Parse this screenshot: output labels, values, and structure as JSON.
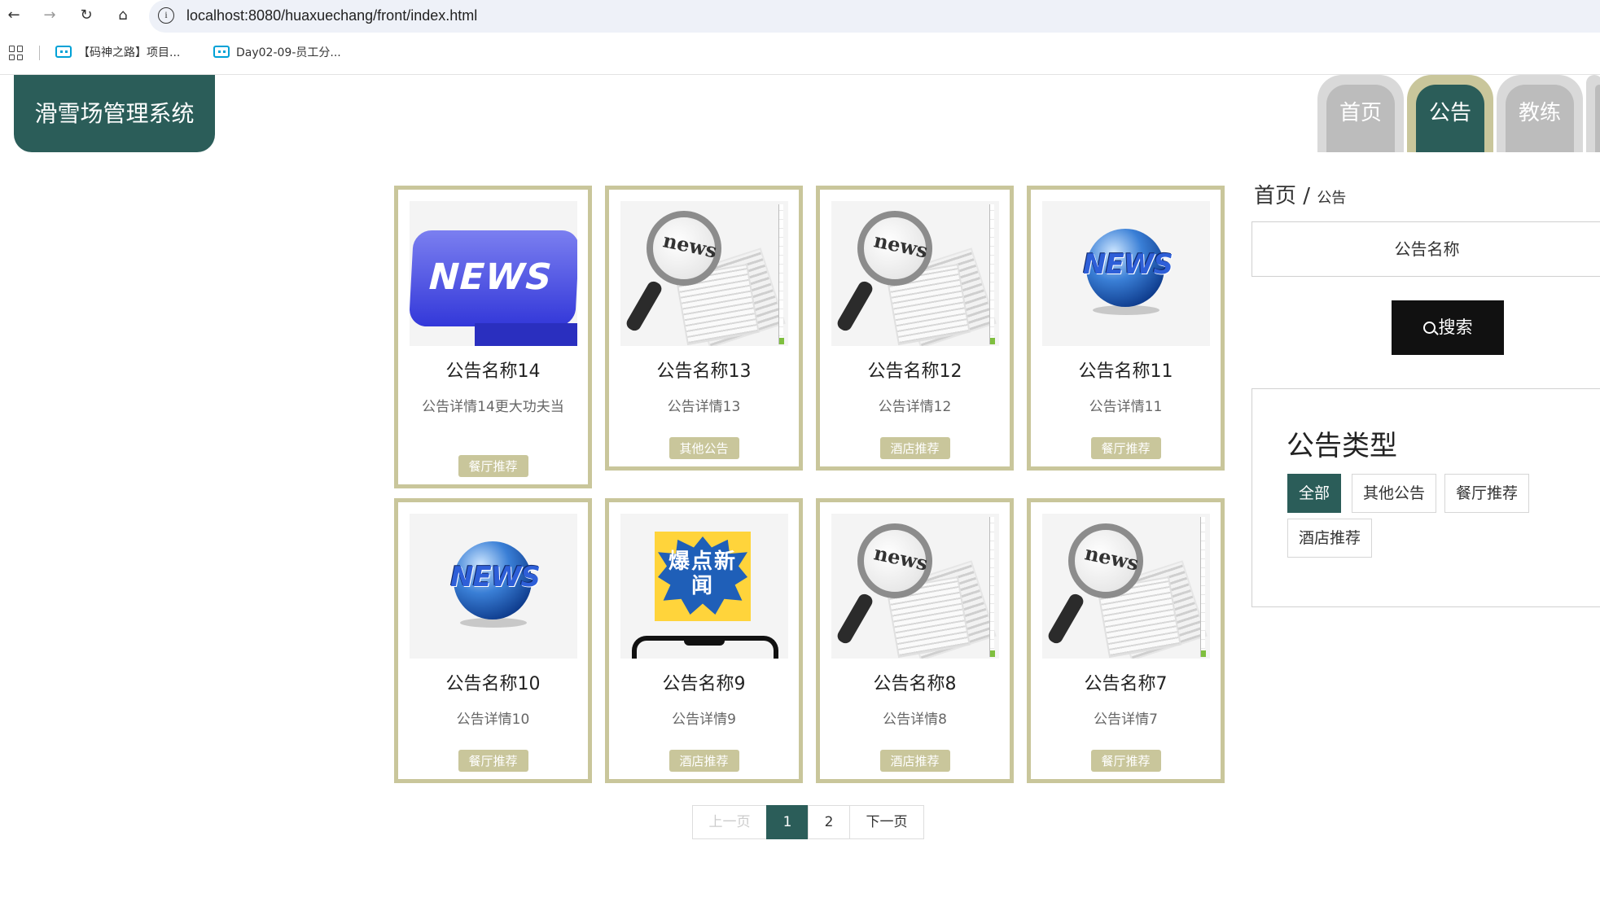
{
  "browser": {
    "url": "localhost:8080/huaxuechang/front/index.html",
    "bookmarks": [
      "【码神之路】项目...",
      "Day02-09-员工分..."
    ]
  },
  "header": {
    "logo_text": "滑雪场管理系统",
    "nav": [
      "首页",
      "公告",
      "教练"
    ],
    "active_nav": "公告"
  },
  "cards": [
    {
      "title": "公告名称14",
      "desc": "公告详情14更大功夫当",
      "tag": "餐厅推荐",
      "image": "news-keyboard-image"
    },
    {
      "title": "公告名称13",
      "desc": "公告详情13",
      "tag": "其他公告",
      "image": "magnifier-newspaper-image"
    },
    {
      "title": "公告名称12",
      "desc": "公告详情12",
      "tag": "酒店推荐",
      "image": "magnifier-newspaper-image"
    },
    {
      "title": "公告名称11",
      "desc": "公告详情11",
      "tag": "餐厅推荐",
      "image": "news-globe-image"
    },
    {
      "title": "公告名称10",
      "desc": "公告详情10",
      "tag": "餐厅推荐",
      "image": "news-globe-image"
    },
    {
      "title": "公告名称9",
      "desc": "公告详情9",
      "tag": "酒店推荐",
      "image": "breaking-news-image"
    },
    {
      "title": "公告名称8",
      "desc": "公告详情8",
      "tag": "酒店推荐",
      "image": "magnifier-newspaper-image"
    },
    {
      "title": "公告名称7",
      "desc": "公告详情7",
      "tag": "餐厅推荐",
      "image": "magnifier-newspaper-image"
    }
  ],
  "image_text": {
    "news_key": "NEWS",
    "magnifier": "news",
    "globe": "NEWS",
    "breaking": "爆点新闻"
  },
  "pagination": {
    "prev": "上一页",
    "pages": [
      "1",
      "2"
    ],
    "current": "1",
    "next": "下一页"
  },
  "sidebar": {
    "breadcrumb_home": "首页",
    "breadcrumb_sep": "/",
    "breadcrumb_current": "公告",
    "search_placeholder": "公告名称",
    "search_button": "搜索",
    "type_title": "公告类型",
    "types": [
      "全部",
      "其他公告",
      "餐厅推荐",
      "酒店推荐"
    ],
    "active_type": "全部"
  },
  "colors": {
    "primary": "#2b5d59",
    "accent": "#c9c69b",
    "tab_inactive": "#bcbcbc"
  }
}
